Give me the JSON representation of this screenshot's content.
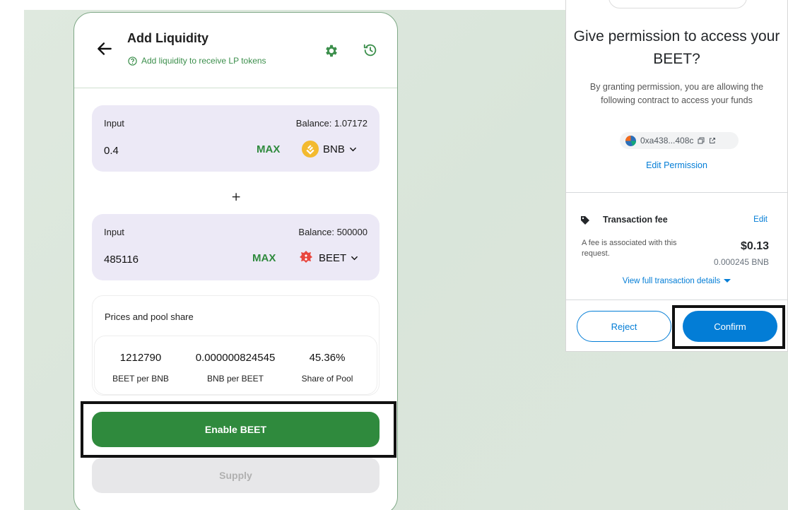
{
  "liquidity": {
    "title": "Add Liquidity",
    "subtitle": "Add liquidity to receive LP tokens",
    "input1": {
      "label": "Input",
      "balance": "Balance: 1.07172",
      "amount": "0.4",
      "max": "MAX",
      "token": "BNB"
    },
    "plus": "+",
    "input2": {
      "label": "Input",
      "balance": "Balance: 500000",
      "amount": "485116",
      "max": "MAX",
      "token": "BEET"
    },
    "prices": {
      "title": "Prices and pool share",
      "items": [
        {
          "value": "1212790",
          "label": "BEET per BNB"
        },
        {
          "value": "0.000000824545",
          "label": "BNB per BEET"
        },
        {
          "value": "45.36%",
          "label": "Share of Pool"
        }
      ]
    },
    "enable_label": "Enable BEET",
    "supply_label": "Supply",
    "colors": {
      "primary": "#2f8a3d",
      "panel": "#ece9f6"
    }
  },
  "wallet": {
    "title": "Give permission to access your BEET?",
    "description": "By granting permission, you are allowing the following contract to access your funds",
    "address": "0xa438...408c",
    "edit_permission": "Edit Permission",
    "fee": {
      "title": "Transaction fee",
      "edit": "Edit",
      "description": "A fee is associated with this request.",
      "usd": "$0.13",
      "bnb": "0.000245 BNB"
    },
    "view_details": "View full transaction details",
    "reject_label": "Reject",
    "confirm_label": "Confirm",
    "colors": {
      "accent": "#037dd6"
    }
  }
}
